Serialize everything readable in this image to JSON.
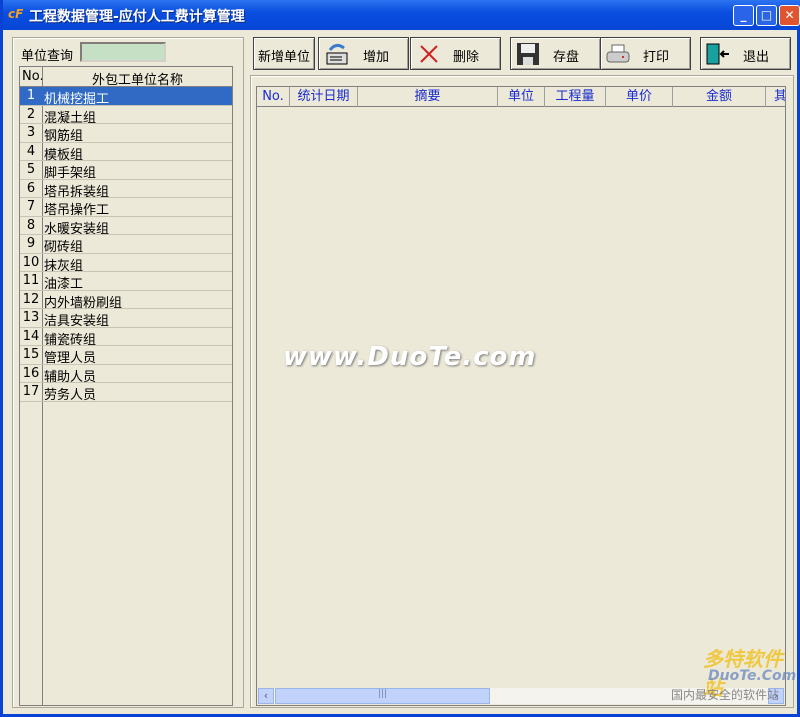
{
  "window": {
    "title": "工程数据管理-应付人工费计算管理",
    "minimize": "_",
    "maximize": "□",
    "close": "✕"
  },
  "left": {
    "search_label": "单位查询",
    "search_value": "",
    "col_no": "No.",
    "col_name": "外包工单位名称",
    "rows": [
      {
        "no": "1",
        "name": "机械挖掘工"
      },
      {
        "no": "2",
        "name": "混凝土组"
      },
      {
        "no": "3",
        "name": "钢筋组"
      },
      {
        "no": "4",
        "name": "模板组"
      },
      {
        "no": "5",
        "name": "脚手架组"
      },
      {
        "no": "6",
        "name": "塔吊拆装组"
      },
      {
        "no": "7",
        "name": "塔吊操作工"
      },
      {
        "no": "8",
        "name": "水暖安装组"
      },
      {
        "no": "9",
        "name": "砌砖组"
      },
      {
        "no": "10",
        "name": "抹灰组"
      },
      {
        "no": "11",
        "name": "油漆工"
      },
      {
        "no": "12",
        "name": "内外墙粉刷组"
      },
      {
        "no": "13",
        "name": "洁具安装组"
      },
      {
        "no": "14",
        "name": "铺瓷砖组"
      },
      {
        "no": "15",
        "name": "管理人员"
      },
      {
        "no": "16",
        "name": "辅助人员"
      },
      {
        "no": "17",
        "name": "劳务人员"
      }
    ],
    "selected": 0
  },
  "toolbar": {
    "new_unit": "新增单位",
    "add": "增加",
    "delete": "删除",
    "save": "存盘",
    "print": "打印",
    "exit": "退出"
  },
  "grid": {
    "columns": [
      "No.",
      "统计日期",
      "摘要",
      "单位",
      "工程量",
      "单价",
      "金额",
      "其"
    ]
  },
  "watermark": {
    "center": "www.DuoTe.com",
    "brand": "多特软件站",
    "brand_en": "DuoTe.Com",
    "slogan": "国内最安全的软件站"
  }
}
